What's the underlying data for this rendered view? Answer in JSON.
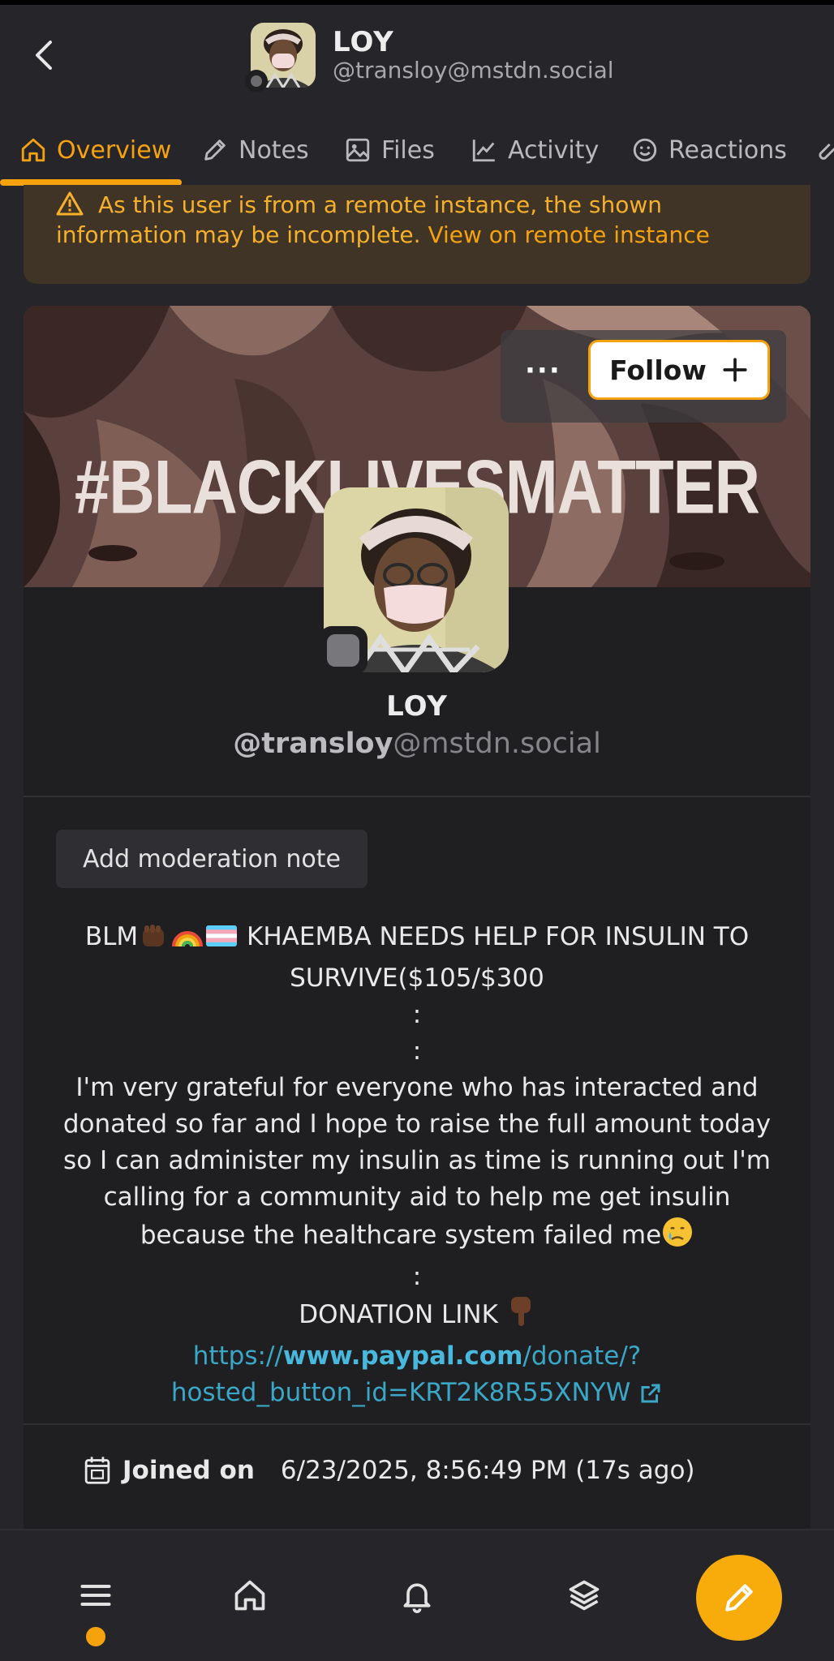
{
  "header": {
    "name": "LOY",
    "handle": "@transloy@mstdn.social"
  },
  "tabs": [
    {
      "label": "Overview",
      "icon": "home-icon",
      "active": true
    },
    {
      "label": "Notes",
      "icon": "pencil-icon"
    },
    {
      "label": "Files",
      "icon": "image-icon"
    },
    {
      "label": "Activity",
      "icon": "chart-line-icon"
    },
    {
      "label": "Reactions",
      "icon": "smile-icon"
    }
  ],
  "warning": {
    "text": "As this user is from a remote instance, the shown information may be incomplete.",
    "link": "View on remote instance"
  },
  "banner": {
    "text": "#BLACKLIVESMATTER"
  },
  "actions": {
    "more": "···",
    "follow": "Follow"
  },
  "profile": {
    "name": "LOY",
    "username": "@transloy",
    "host": "@mstdn.social"
  },
  "moderation": {
    "button": "Add moderation note"
  },
  "bio": {
    "line1_prefix": "BLM",
    "line1_text": " KHAEMBA NEEDS HELP FOR INSULIN TO SURVIVE($105/$300",
    "sep": ":",
    "paragraph": "I'm very grateful for everyone who has interacted and donated so far and I hope to raise the full amount today so I can administer my insulin as time is running out I'm calling for a community aid to help me get insulin because the healthcare system failed me",
    "donation_label": "DONATION LINK",
    "link_prefix": "https://",
    "link_host": "www.paypal.com",
    "link_path": "/donate/?hosted_button_id=KRT2K8R55XNYW"
  },
  "joined": {
    "label": "Joined on",
    "value": "6/23/2025, 8:56:49 PM (17s ago)"
  },
  "colors": {
    "accent": "#f6a20d",
    "background": "#26262a",
    "card": "#1f1f22",
    "warning_bg": "#3f3426",
    "link": "#3aa7c6"
  },
  "bottom_nav": [
    {
      "icon": "menu-icon"
    },
    {
      "icon": "home-icon"
    },
    {
      "icon": "bell-icon"
    },
    {
      "icon": "layers-icon"
    },
    {
      "icon": "pencil-icon"
    }
  ]
}
